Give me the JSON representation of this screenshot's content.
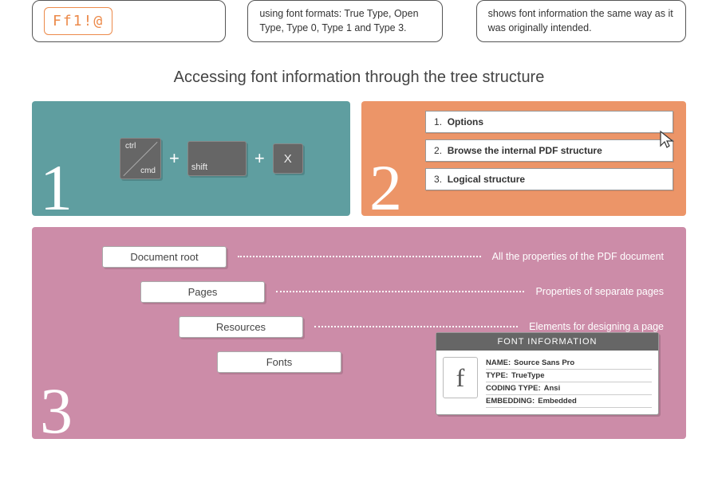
{
  "top": {
    "sample": "Ff1!@",
    "box_b": "using font formats: True Type, Open Type, Type 0, Type 1 and Type 3.",
    "box_c": "shows font information the same way as it was originally intended."
  },
  "heading": "Accessing font information through the tree structure",
  "step1": {
    "num": "1",
    "key_ctrl_top": "ctrl",
    "key_ctrl_bot": "cmd",
    "key_shift": "shift",
    "key_x": "X",
    "plus": "+"
  },
  "step2": {
    "num": "2",
    "items": [
      {
        "n": "1.",
        "label": "Options"
      },
      {
        "n": "2.",
        "label": "Browse the internal PDF structure"
      },
      {
        "n": "3.",
        "label": "Logical structure"
      }
    ]
  },
  "step3": {
    "num": "3",
    "rows": [
      {
        "node": "Document root",
        "desc": "All the properties of the PDF document"
      },
      {
        "node": "Pages",
        "desc": "Properties of separate pages"
      },
      {
        "node": "Resources",
        "desc": "Elements for designing a page"
      },
      {
        "node": "Fonts",
        "desc": ""
      }
    ],
    "card": {
      "title": "FONT INFORMATION",
      "glyph": "f",
      "props": [
        {
          "k": "NAME:",
          "v": "Source Sans Pro"
        },
        {
          "k": "TYPE:",
          "v": "TrueType"
        },
        {
          "k": "CODING TYPE:",
          "v": "Ansi"
        },
        {
          "k": "EMBEDDING:",
          "v": "Embedded"
        }
      ]
    }
  }
}
